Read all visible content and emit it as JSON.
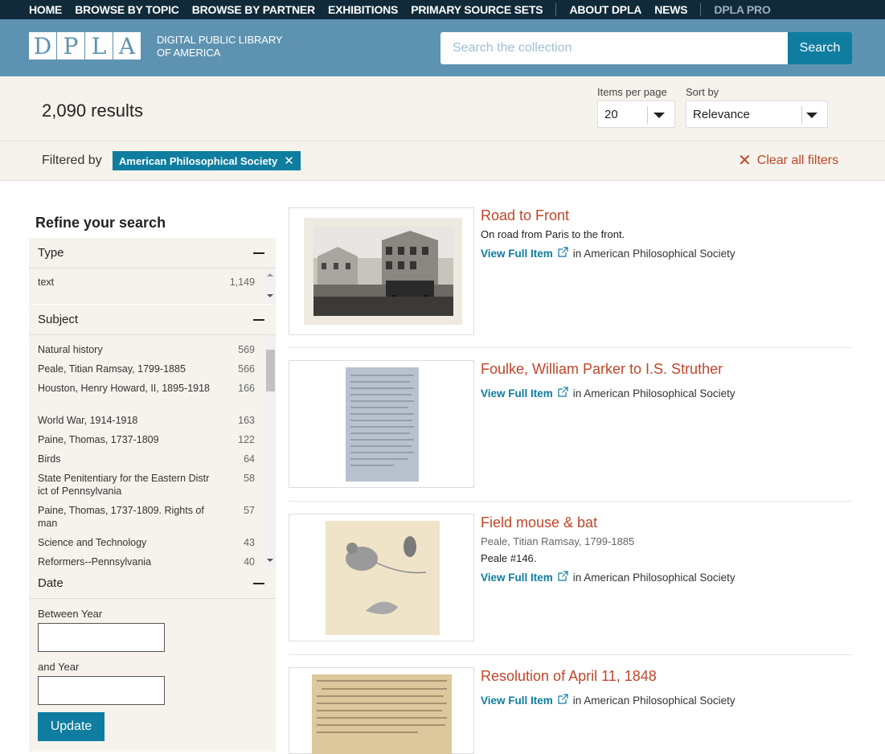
{
  "nav": {
    "items": [
      "HOME",
      "BROWSE BY TOPIC",
      "BROWSE BY PARTNER",
      "EXHIBITIONS",
      "PRIMARY SOURCE SETS"
    ],
    "items2": [
      "ABOUT DPLA",
      "NEWS"
    ],
    "pro": "DPLA PRO"
  },
  "header": {
    "logo_letters": [
      "D",
      "P",
      "L",
      "A"
    ],
    "logo_line1": "DIGITAL PUBLIC LIBRARY",
    "logo_line2": "OF AMERICA",
    "search_placeholder": "Search the collection",
    "search_button": "Search"
  },
  "results": {
    "count": "2,090 results",
    "items_per_page_label": "Items per page",
    "items_per_page_value": "20",
    "sort_label": "Sort by",
    "sort_value": "Relevance"
  },
  "filters": {
    "label": "Filtered by",
    "active": "American Philosophical Society",
    "clear_all": "Clear all filters"
  },
  "sidebar": {
    "title": "Refine your search",
    "type": {
      "label": "Type",
      "rows": [
        {
          "name": "text",
          "count": "1,149"
        }
      ]
    },
    "subject": {
      "label": "Subject",
      "rows": [
        {
          "name": "Natural history",
          "count": "569"
        },
        {
          "name": "Peale, Titian Ramsay, 1799-1885",
          "count": "566"
        },
        {
          "name": "Houston, Henry Howard, II, 1895-1918",
          "count": "166"
        },
        {
          "name": "World War, 1914-1918",
          "count": "163"
        },
        {
          "name": "Paine, Thomas, 1737-1809",
          "count": "122"
        },
        {
          "name": "Birds",
          "count": "64"
        },
        {
          "name": "State Penitentiary for the Eastern District of Pennsylvania",
          "count": "58"
        },
        {
          "name": "Paine, Thomas, 1737-1809. Rights of man",
          "count": "57"
        },
        {
          "name": "Science and Technology",
          "count": "43"
        },
        {
          "name": "Reformers--Pennsylvania",
          "count": "40"
        }
      ]
    },
    "date": {
      "label": "Date",
      "between_label": "Between Year",
      "and_label": "and Year",
      "update_button": "Update"
    }
  },
  "items": [
    {
      "title": "Road to Front",
      "creator": "",
      "description": "On road from Paris to the front.",
      "view": "View Full Item",
      "partner": "in American Philosophical Society"
    },
    {
      "title": "Foulke, William Parker to I.S. Struther",
      "creator": "",
      "description": "",
      "view": "View Full Item",
      "partner": "in American Philosophical Society"
    },
    {
      "title": "Field mouse & bat",
      "creator": "Peale, Titian Ramsay, 1799-1885",
      "description": "Peale #146.",
      "view": "View Full Item",
      "partner": "in American Philosophical Society"
    },
    {
      "title": "Resolution of April 11, 1848",
      "creator": "",
      "description": "",
      "view": "View Full Item",
      "partner": "in American Philosophical Society"
    }
  ],
  "colors": {
    "accent": "#0f7d9f",
    "header_bg": "#5d93b1",
    "nav_bg": "#102a3a",
    "title_red": "#c0462a",
    "panel_bg": "#f6f3ec"
  }
}
